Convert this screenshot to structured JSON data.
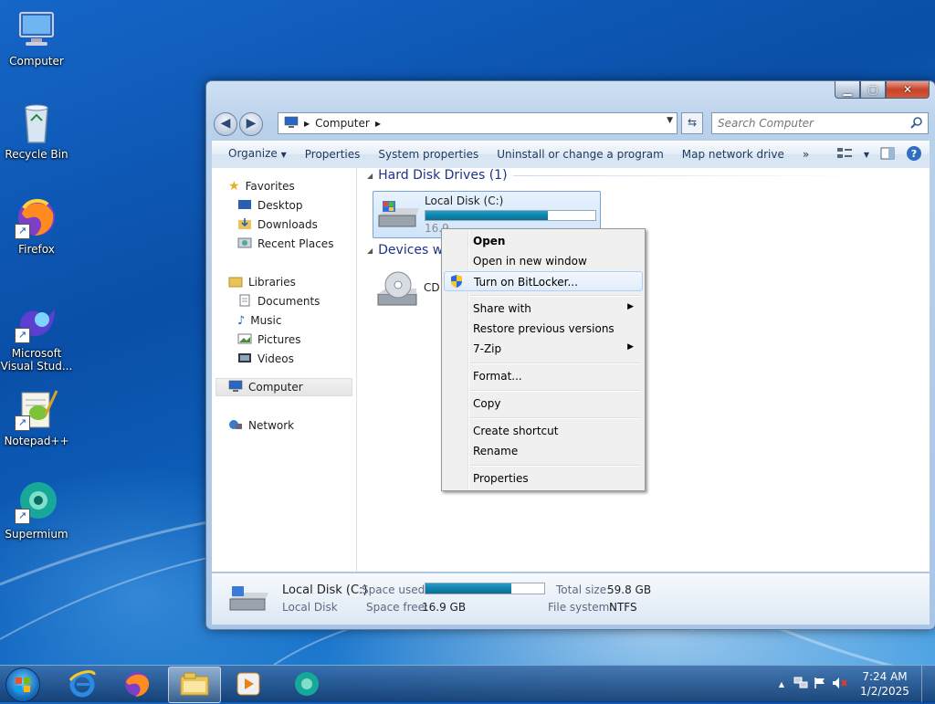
{
  "desktop": {
    "icons": [
      {
        "label": "Computer"
      },
      {
        "label": "Recycle Bin"
      },
      {
        "label": "Firefox"
      },
      {
        "label_line1": "Microsoft",
        "label_line2": "Visual Stud..."
      },
      {
        "label": "Notepad++"
      },
      {
        "label": "Supermium"
      }
    ]
  },
  "window": {
    "address_crumb": "Computer",
    "search_placeholder": "Search Computer",
    "toolbar": {
      "organize": "Organize",
      "properties": "Properties",
      "system_properties": "System properties",
      "uninstall": "Uninstall or change a program",
      "map_drive": "Map network drive",
      "more": "»"
    },
    "nav": {
      "favorites": "Favorites",
      "desktop": "Desktop",
      "downloads": "Downloads",
      "recent": "Recent Places",
      "libraries": "Libraries",
      "documents": "Documents",
      "music": "Music",
      "pictures": "Pictures",
      "videos": "Videos",
      "computer": "Computer",
      "network": "Network"
    },
    "groups": {
      "hdd": "Hard Disk Drives (1)",
      "devices": "Devices wi"
    },
    "drive": {
      "name": "Local Disk (C:)",
      "sub": "16.9",
      "used_fraction": 0.72
    },
    "cd_label": "CD",
    "details": {
      "name": "Local Disk (C:)",
      "type": "Local Disk",
      "space_used_label": "Space used:",
      "space_free_label": "Space free:",
      "space_free": "16.9 GB",
      "total_size_label": "Total size:",
      "total_size": "59.8 GB",
      "file_system_label": "File system:",
      "file_system": "NTFS"
    }
  },
  "context_menu": {
    "open": "Open",
    "open_new": "Open in new window",
    "bitlocker": "Turn on BitLocker...",
    "share": "Share with",
    "restore": "Restore previous versions",
    "zip": "7-Zip",
    "format": "Format...",
    "copy": "Copy",
    "shortcut": "Create shortcut",
    "rename": "Rename",
    "properties": "Properties"
  },
  "taskbar": {
    "time": "7:24 AM",
    "date": "1/2/2025"
  }
}
